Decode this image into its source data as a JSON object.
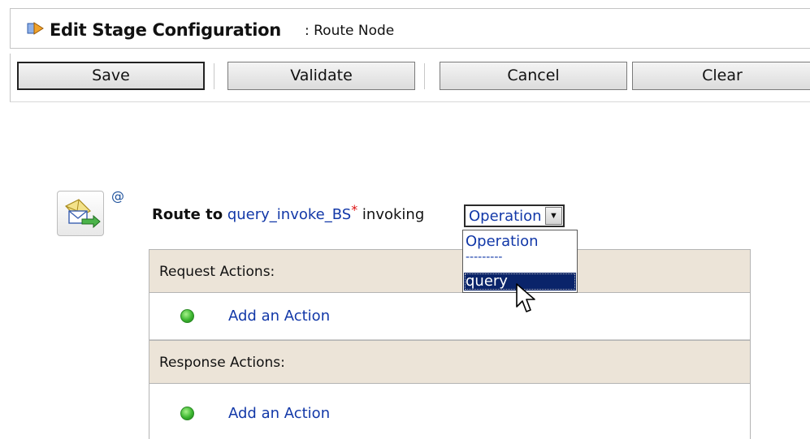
{
  "header": {
    "title": "Edit Stage Configuration",
    "subtitle": ": Route Node",
    "icon": "stage-config-icon"
  },
  "toolbar": {
    "buttons": [
      {
        "label": "Save"
      },
      {
        "label": "Validate"
      },
      {
        "label": "Cancel"
      },
      {
        "label": "Clear"
      }
    ]
  },
  "route": {
    "label": "Route to",
    "target": "query_invoke_BS",
    "required_marker": "*",
    "invoking_text": "invoking",
    "operation_select": {
      "value": "Operation",
      "options": [
        "Operation",
        "---------",
        "query"
      ],
      "highlighted": "query"
    }
  },
  "stage": {
    "at_label": "@",
    "icon": "route-envelope-icon"
  },
  "request_actions": {
    "header": "Request Actions:",
    "add_action": "Add an Action"
  },
  "response_actions": {
    "header": "Response Actions:",
    "add_action": "Add an Action"
  },
  "colors": {
    "link": "#1238a8",
    "section_bg": "#ece4d8",
    "selection": "#0a246a",
    "required": "#dd1111"
  }
}
